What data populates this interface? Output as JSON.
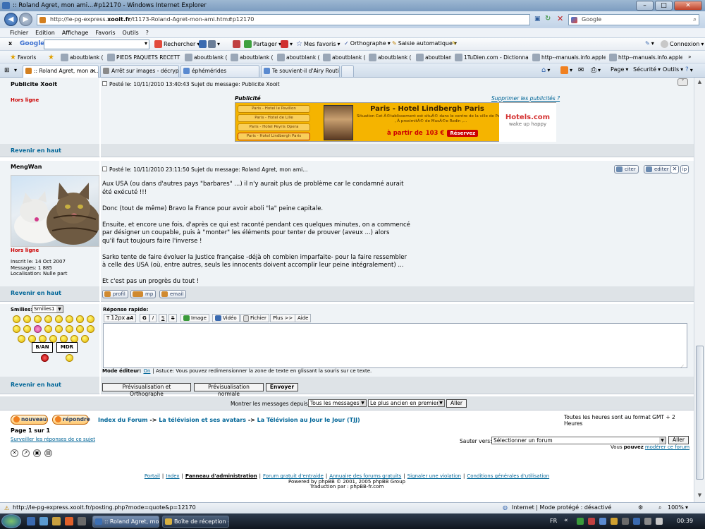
{
  "window": {
    "title": ":: Roland Agret, mon ami...#p12170 - Windows Internet Explorer",
    "min": "–",
    "max": "□",
    "close": "✕"
  },
  "nav": {
    "url_prefix": "http://le-pg-express.",
    "url_domain": "xooit.fr",
    "url_rest": "/t1173-Roland-Agret-mon-ami.htm#p12170",
    "search_placeholder": "Google"
  },
  "menu": [
    "Fichier",
    "Edition",
    "Affichage",
    "Favoris",
    "Outils",
    "?"
  ],
  "google_toolbar": {
    "close": "x",
    "logo": "Google",
    "rechercher": "Rechercher",
    "partager": "Partager",
    "mes_favoris": "Mes favoris",
    "orthographe": "Orthographe",
    "saisie": "Saisie automatique",
    "connexion": "Connexion"
  },
  "favorites": {
    "label": "Favoris",
    "items": [
      "aboutblank (8)",
      "PIEDS PAQUETS  RECETTE...",
      "aboutblank (5)",
      "aboutblank (6)",
      "aboutblank (4)",
      "aboutblank (3)",
      "aboutblank (2)",
      "aboutblank",
      "1TuDien.com - Dictionnai...",
      "http--manuals.info.apple....",
      "http--manuals.info.apple...."
    ]
  },
  "tabs": [
    ":: Roland Agret, mon a...",
    "Arrêt sur images - décrypt...",
    "éphémérides",
    "Te souvient-il d'Airy Routi..."
  ],
  "commands": {
    "page": "Page",
    "securite": "Sécurité",
    "outils": "Outils"
  },
  "post1": {
    "author": "Publicite Xooit",
    "status": "Hors ligne",
    "meta": "Posté le: 10/11/2010 13:40:43    Sujet du message: Publicite Xooit",
    "pub_label": "Publicité",
    "remove_ads": "Supprimer les publicités ?",
    "ad_items": [
      "Paris - Hotel le Pavillon",
      "Paris - Hotel de Lille",
      "Paris - Hotel Peyris Opera",
      "Paris - Hotel Lindbergh Paris"
    ],
    "ad_title": "Paris - Hotel Lindbergh Paris",
    "ad_text": "Situation   Cet Ã©tablissement est situÃ© dans le centre de la ville de  Paris , Ã  proximitÃ© de MusÃ©e Rodin ,...",
    "ad_price_prefix": "à partir de",
    "ad_price": "103 €",
    "ad_reserve": "Réservez",
    "ad_brand": "Hotels.com",
    "ad_slogan": "wake up happy",
    "back_top": "Revenir en haut"
  },
  "post2": {
    "author": "MengWan",
    "status": "Hors ligne",
    "inscrit": "Inscrit le: 14 Oct 2007",
    "messages": "Messages: 1 885",
    "localisation": "Localisation: Nulle part",
    "meta": "Posté le: 10/11/2010 23:11:50    Sujet du message: Roland Agret, mon ami...",
    "citer": "citer",
    "editer": "editer",
    "lines": [
      "Aux USA (ou dans d'autres pays \"barbares\" ...) il n'y aurait plus de problème car le condamné aurait",
      "été exécuté !!!",
      "",
      "Donc (tout de même) Bravo la France pour avoir aboli \"la\" peine capitale.",
      "",
      "Ensuite, et encore une fois, d'après ce qui est raconté pendant ces quelques minutes, on a commencé",
      "par désigner un coupable, puis à \"monter\" les éléments pour tenter de prouver (aveux ...) alors",
      "qu'il faut toujours faire l'inverse !",
      "",
      "Sarko tente de faire évoluer la Justice française -déjà oh combien imparfaite- pour la faire ressembler",
      "à celle des USA (où, entre autres, seuls les innocents doivent accomplir leur peine intégralement) ...",
      "",
      "Et c'est pas un progrès du tout !"
    ],
    "back_top": "Revenir en haut",
    "profil": "profil",
    "mp": "mp",
    "email": "email"
  },
  "reply": {
    "smilies_label": "Smilies:",
    "smilies_select": "Smilies1",
    "quick_reply": "Réponse rapide:",
    "font_size": "12px",
    "tools": [
      "Image",
      "Vidéo",
      "Fichier",
      "Plus >>",
      "Aide"
    ],
    "badge1": "B/AN",
    "badge2": "MDR",
    "mode_label": "Mode éditeur:",
    "mode_value": "On",
    "mode_tip": "| Astuce: Vous pouvez redimensionner la zone de texte en glissant la souris sur ce texte.",
    "back_top": "Revenir en haut",
    "btn_preview_ortho": "Prévisualisation et Orthographe",
    "btn_preview": "Prévisualisation normale",
    "btn_send": "Envoyer"
  },
  "display": {
    "label": "Montrer les messages depuis:",
    "select1": "Tous les messages",
    "select2": "Le plus ancien en premier",
    "go": "Aller"
  },
  "bottom": {
    "nouveau": "nouveau",
    "repondre": "répondre",
    "breadcrumb_1": "Index du Forum",
    "breadcrumb_sep": " -> ",
    "breadcrumb_2": "La télévision et ses avatars",
    "breadcrumb_3": "La Télévision au Jour le Jour (TJJ)",
    "timezone": "Toutes les heures sont au format GMT + 2 Heures",
    "page": "Page 1 sur 1",
    "watch": "Surveiller les réponses de ce sujet",
    "jump_label": "Sauter vers:",
    "jump_select": "Sélectionner un forum",
    "jump_go": "Aller",
    "mod_prefix": "Vous",
    "mod_bold": "pouvez",
    "mod_link": "modérer ce forum"
  },
  "footer": {
    "links": [
      "Portail",
      "Index",
      "Panneau d'administration",
      "Forum gratuit d'entraide",
      "Annuaire des forums gratuits",
      "Signaler une violation",
      "Conditions générales d'utilisation"
    ],
    "powered": "Powered by phpBB © 2001, 2005 phpBB Group",
    "traduction": "Traduction par : phpBB-fr.com"
  },
  "status": {
    "url": "http://le-pg-express.xooit.fr/posting.php?mode=quote&p=12170",
    "zone": "Internet | Mode protégé : désactivé",
    "zoom": "100%"
  },
  "taskbar": {
    "items": [
      ":: Roland Agret, mon...",
      "Boîte de réception - ..."
    ],
    "lang": "FR",
    "clock": "00:39"
  },
  "colors": {
    "link": "#006597",
    "offline": "#cc0000",
    "row_light": "#eff3f6",
    "row_dark": "#dee3e7",
    "ad_orange": "#f5b400"
  }
}
